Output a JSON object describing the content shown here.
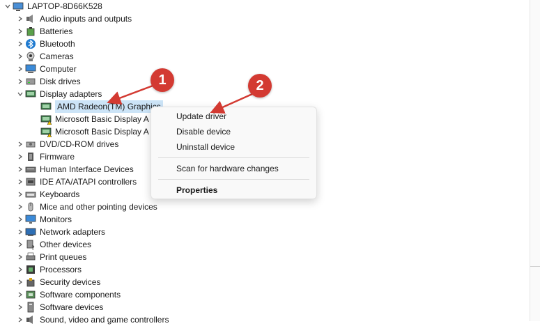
{
  "tree": {
    "root": "LAPTOP-8D66K528",
    "categories": [
      {
        "label": "Audio inputs and outputs",
        "icon": "speaker-icon"
      },
      {
        "label": "Batteries",
        "icon": "battery-icon"
      },
      {
        "label": "Bluetooth",
        "icon": "bluetooth-icon"
      },
      {
        "label": "Cameras",
        "icon": "camera-icon"
      },
      {
        "label": "Computer",
        "icon": "computer-icon"
      },
      {
        "label": "Disk drives",
        "icon": "disk-drive-icon"
      },
      {
        "label": "Display adapters",
        "icon": "display-adapter-icon",
        "expanded": true
      },
      {
        "label": "DVD/CD-ROM drives",
        "icon": "dvd-drive-icon"
      },
      {
        "label": "Firmware",
        "icon": "chip-icon"
      },
      {
        "label": "Human Interface Devices",
        "icon": "hid-icon"
      },
      {
        "label": "IDE ATA/ATAPI controllers",
        "icon": "ide-controller-icon"
      },
      {
        "label": "Keyboards",
        "icon": "keyboard-icon"
      },
      {
        "label": "Mice and other pointing devices",
        "icon": "mouse-icon"
      },
      {
        "label": "Monitors",
        "icon": "monitor-icon"
      },
      {
        "label": "Network adapters",
        "icon": "network-adapter-icon"
      },
      {
        "label": "Other devices",
        "icon": "other-devices-icon"
      },
      {
        "label": "Print queues",
        "icon": "printer-icon"
      },
      {
        "label": "Processors",
        "icon": "processor-icon"
      },
      {
        "label": "Security devices",
        "icon": "security-device-icon"
      },
      {
        "label": "Software components",
        "icon": "software-component-icon"
      },
      {
        "label": "Software devices",
        "icon": "software-device-icon"
      },
      {
        "label": "Sound, video and game controllers",
        "icon": "sound-controller-icon"
      }
    ],
    "display_children": [
      {
        "label": "AMD Radeon(TM) Graphics",
        "icon": "display-adapter-icon",
        "selected": true
      },
      {
        "label": "Microsoft Basic Display A",
        "icon": "display-adapter-warning-icon"
      },
      {
        "label": "Microsoft Basic Display A",
        "icon": "display-adapter-warning-icon"
      }
    ]
  },
  "context_menu": {
    "items": [
      "Update driver",
      "Disable device",
      "Uninstall device"
    ],
    "scan": "Scan for hardware changes",
    "properties": "Properties"
  },
  "callouts": [
    "1",
    "2"
  ],
  "colors": {
    "callout": "#d33a32",
    "selection": "#cce4f7"
  }
}
